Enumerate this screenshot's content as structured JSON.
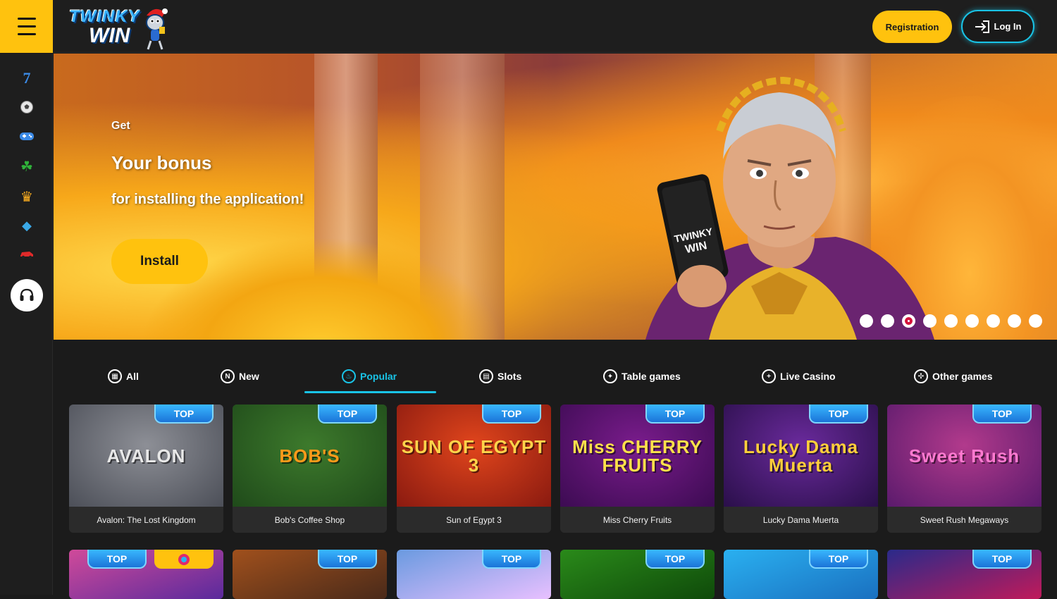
{
  "header": {
    "logo_line1": "TWINKY",
    "logo_line2": "WIN",
    "registration_label": "Registration",
    "login_label": "Log In"
  },
  "sidebar": {
    "items": [
      {
        "icon": "slot-seven-icon",
        "glyph": "7"
      },
      {
        "icon": "soccer-ball-icon",
        "glyph": "⚽"
      },
      {
        "icon": "gamepad-icon",
        "glyph": "🎮"
      },
      {
        "icon": "clover-icon",
        "glyph": "☘"
      },
      {
        "icon": "crown-icon",
        "glyph": "♛"
      },
      {
        "icon": "diamond-icon",
        "glyph": "◆"
      },
      {
        "icon": "car-icon",
        "glyph": "🚗"
      }
    ],
    "support_icon": "headset-icon"
  },
  "banner": {
    "get": "Get",
    "title": "Your bonus",
    "subtitle": "for installing the application!",
    "install_label": "Install",
    "phone_logo_line1": "TWINKY",
    "phone_logo_line2": "WIN",
    "slides_total": 9,
    "active_slide": 3
  },
  "categories": [
    {
      "label": "All",
      "icon": "grid-icon",
      "glyph": "▦"
    },
    {
      "label": "New",
      "icon": "new-icon",
      "glyph": "N"
    },
    {
      "label": "Popular",
      "icon": "popular-icon",
      "glyph": "♨",
      "active": true
    },
    {
      "label": "Slots",
      "icon": "slots-icon",
      "glyph": "▤"
    },
    {
      "label": "Table games",
      "icon": "table-games-icon",
      "glyph": "✦"
    },
    {
      "label": "Live Casino",
      "icon": "live-casino-icon",
      "glyph": "+"
    },
    {
      "label": "Other games",
      "icon": "other-games-icon",
      "glyph": "✣"
    }
  ],
  "badge_top": "TOP",
  "games_row1": [
    {
      "name": "Avalon: The Lost Kingdom",
      "art": "AVALON",
      "colors": [
        "#8d8f96",
        "#4c4f58"
      ],
      "text_color": "#e8e8e8"
    },
    {
      "name": "Bob's Coffee Shop",
      "art": "BOB'S",
      "colors": [
        "#3d7a2c",
        "#1f4a1a"
      ],
      "text_color": "#ff9a1a"
    },
    {
      "name": "Sun of Egypt 3",
      "art": "SUN OF EGYPT 3",
      "colors": [
        "#e0451c",
        "#8a1a10"
      ],
      "text_color": "#ffd34a"
    },
    {
      "name": "Miss Cherry Fruits",
      "art": "Miss CHERRY FRUITS",
      "colors": [
        "#7a1c8c",
        "#3c0b52"
      ],
      "text_color": "#ffe04a"
    },
    {
      "name": "Lucky Dama Muerta",
      "art": "Lucky Dama Muerta",
      "colors": [
        "#6a2a9c",
        "#2a0f4a"
      ],
      "text_color": "#ffcf3a"
    },
    {
      "name": "Sweet Rush Megaways",
      "art": "Sweet Rush",
      "colors": [
        "#b23a8c",
        "#5a1a6c"
      ],
      "text_color": "#ff7ad0"
    }
  ],
  "games_row2": [
    {
      "colors": [
        "#d04a9a",
        "#5a2a9c"
      ],
      "badge": "TOP",
      "provider_badge": true
    },
    {
      "colors": [
        "#a0501c",
        "#4a2a1a"
      ],
      "badge": "TOP"
    },
    {
      "colors": [
        "#6a9ae0",
        "#e8c0ff"
      ],
      "badge": "TOP"
    },
    {
      "colors": [
        "#2a8a1a",
        "#0f4a0a"
      ],
      "badge": "TOP"
    },
    {
      "colors": [
        "#2ab0f0",
        "#1a70c0"
      ],
      "badge": "TOP"
    },
    {
      "colors": [
        "#2a2a8a",
        "#c01a5a"
      ],
      "badge": "TOP"
    }
  ],
  "colors": {
    "accent_yellow": "#ffc20e",
    "accent_cyan": "#19c3e6",
    "background": "#1b1b1b",
    "slide_active": "#d4143c"
  }
}
